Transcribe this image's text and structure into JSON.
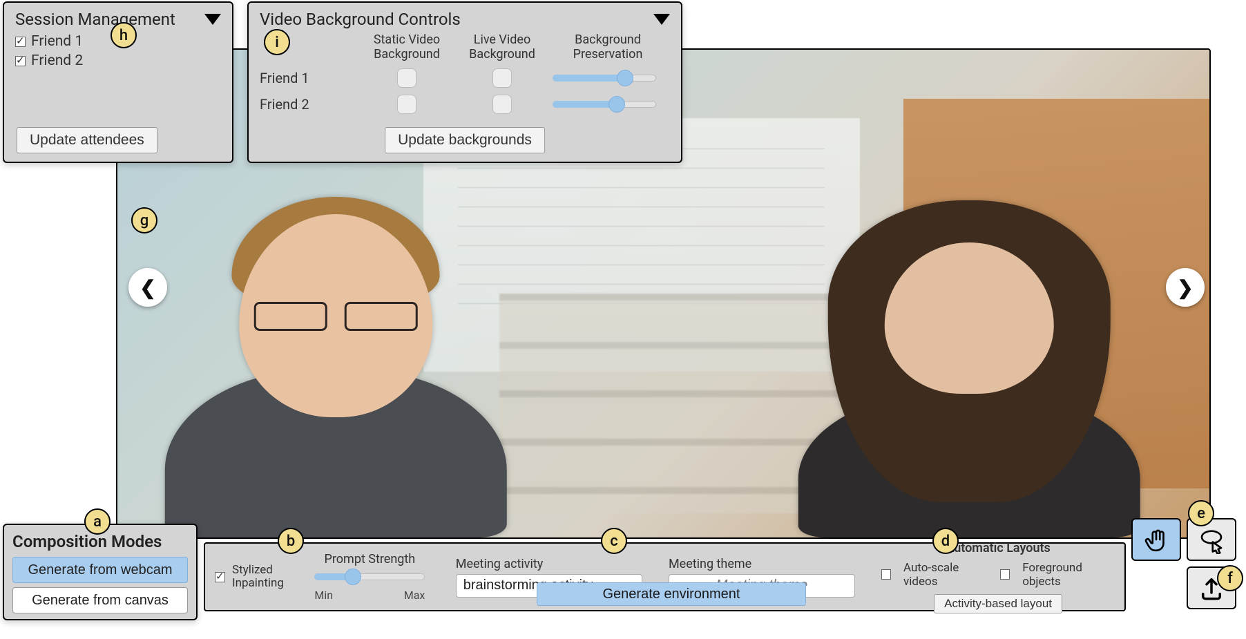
{
  "session": {
    "title": "Session Management",
    "attendees": [
      {
        "label": "Friend 1",
        "checked": true
      },
      {
        "label": "Friend 2",
        "checked": true
      }
    ],
    "update_btn": "Update attendees"
  },
  "vbc": {
    "title": "Video Background Controls",
    "columns": {
      "static": "Static Video\nBackground",
      "live": "Live Video\nBackground",
      "preserve": "Background\nPreservation"
    },
    "rows": [
      {
        "label": "Friend 1",
        "static": false,
        "live": false,
        "preserve_pct": 70
      },
      {
        "label": "Friend 2",
        "static": false,
        "live": false,
        "preserve_pct": 62
      }
    ],
    "update_btn": "Update backgrounds"
  },
  "composition": {
    "title": "Composition Modes",
    "webcam_btn": "Generate from webcam",
    "canvas_btn": "Generate from canvas",
    "active": "webcam"
  },
  "bottom": {
    "stylized_label": "Stylized\nInpainting",
    "stylized_checked": true,
    "strength_label": "Prompt Strength",
    "strength_min": "Min",
    "strength_max": "Max",
    "strength_pct": 35,
    "activity_label": "Meeting activity",
    "activity_value": "brainstorming activity",
    "theme_label": "Meeting theme",
    "theme_placeholder": "Meeting theme",
    "theme_value": "",
    "gen_env_btn": "Generate environment",
    "auto_title": "Automatic Layouts",
    "auto_scale_label": "Auto-scale videos",
    "auto_scale_checked": false,
    "foreground_label": "Foreground objects",
    "foreground_checked": false,
    "activity_layout_btn": "Activity-based layout"
  },
  "tools": {
    "move_active": true
  },
  "callouts": {
    "a": "a",
    "b": "b",
    "c": "c",
    "d": "d",
    "e": "e",
    "f": "f",
    "g": "g",
    "h": "h",
    "i": "i"
  }
}
